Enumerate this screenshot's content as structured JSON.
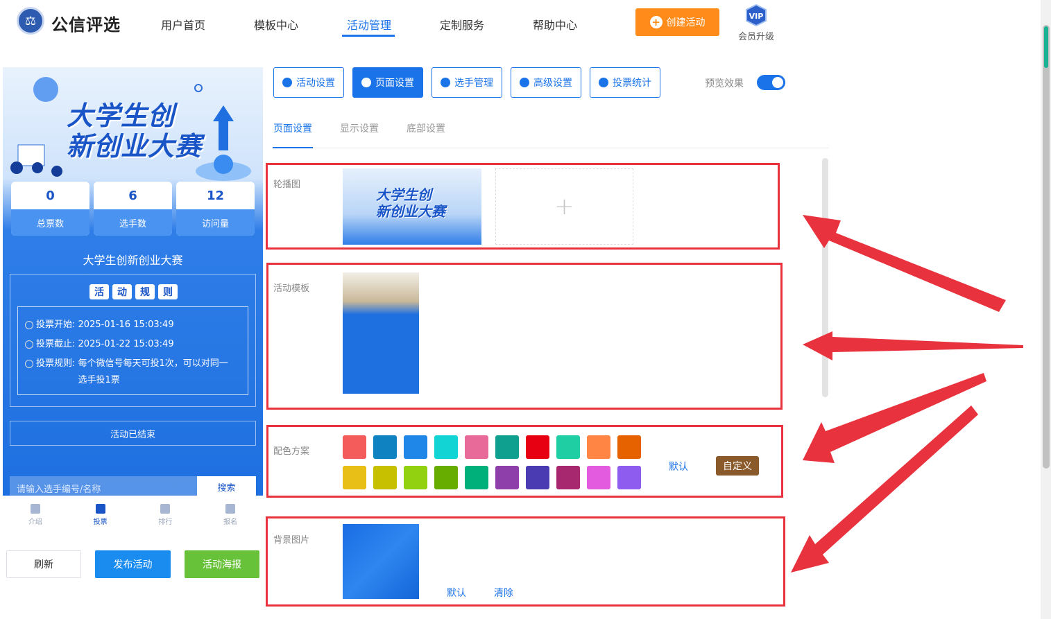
{
  "header": {
    "brand": "公信评选",
    "nav": [
      "用户首页",
      "模板中心",
      "活动管理",
      "定制服务",
      "帮助中心"
    ],
    "active_nav": "活动管理",
    "create_button": "创建活动",
    "vip_badge": "VIP",
    "vip_label": "会员升级"
  },
  "preview": {
    "banner_title_line1": "大学生创",
    "banner_title_line2": "新创业大赛",
    "stats": [
      {
        "value": "0",
        "label": "总票数"
      },
      {
        "value": "6",
        "label": "选手数"
      },
      {
        "value": "12",
        "label": "访问量"
      }
    ],
    "activity_title": "大学生创新创业大赛",
    "rules_title_chars": [
      "活",
      "动",
      "规",
      "则"
    ],
    "rules": [
      {
        "label": "投票开始:",
        "value": "2025-01-16 15:03:49"
      },
      {
        "label": "投票截止:",
        "value": "2025-01-22 15:03:49"
      },
      {
        "label": "投票规则:",
        "value": "每个微信号每天可投1次，可以对同一选手投1票"
      }
    ],
    "status": "活动已结束",
    "search_placeholder": "请输入选手编号/名称",
    "search_button": "搜索",
    "tabbar": [
      {
        "label": "介绍",
        "icon": "document-icon"
      },
      {
        "label": "投票",
        "icon": "flag-icon"
      },
      {
        "label": "排行",
        "icon": "bar-chart-icon"
      },
      {
        "label": "报名",
        "icon": "hand-icon"
      }
    ],
    "active_tab": "投票"
  },
  "bottom_buttons": {
    "refresh": "刷新",
    "publish": "发布活动",
    "poster": "活动海报"
  },
  "toolbar": {
    "buttons": [
      "活动设置",
      "页面设置",
      "选手管理",
      "高级设置",
      "投票统计"
    ],
    "active": "页面设置",
    "preview_label": "预览效果",
    "preview_on": true
  },
  "subtabs": [
    "页面设置",
    "显示设置",
    "底部设置"
  ],
  "active_subtab": "页面设置",
  "sections": {
    "carousel_label": "轮播图",
    "carousel_thumb_title1": "大学生创",
    "carousel_thumb_title2": "新创业大赛",
    "template_label": "活动模板",
    "color_label": "配色方案",
    "color_default": "默认",
    "color_custom": "自定义",
    "background_label": "背景图片",
    "background_default": "默认",
    "background_clear": "清除"
  },
  "colors": {
    "primary": "#1a73e8",
    "highlight_red": "#e8323d",
    "orange": "#ff8c1a",
    "green": "#67c23a",
    "swatches_row1": [
      "#f45b5b",
      "#0f83c2",
      "#1f87e8",
      "#13d4d4",
      "#e86a99",
      "#0fa08f",
      "#e60012",
      "#1fcfa3",
      "#ff8545",
      "#e66100"
    ],
    "swatches_row2": [
      "#e8bf17",
      "#c7c000",
      "#91d10f",
      "#67ad00",
      "#00b07a",
      "#8e3fa9",
      "#4a3bb3",
      "#a8286f",
      "#e35ce0",
      "#8f5cf0"
    ]
  }
}
